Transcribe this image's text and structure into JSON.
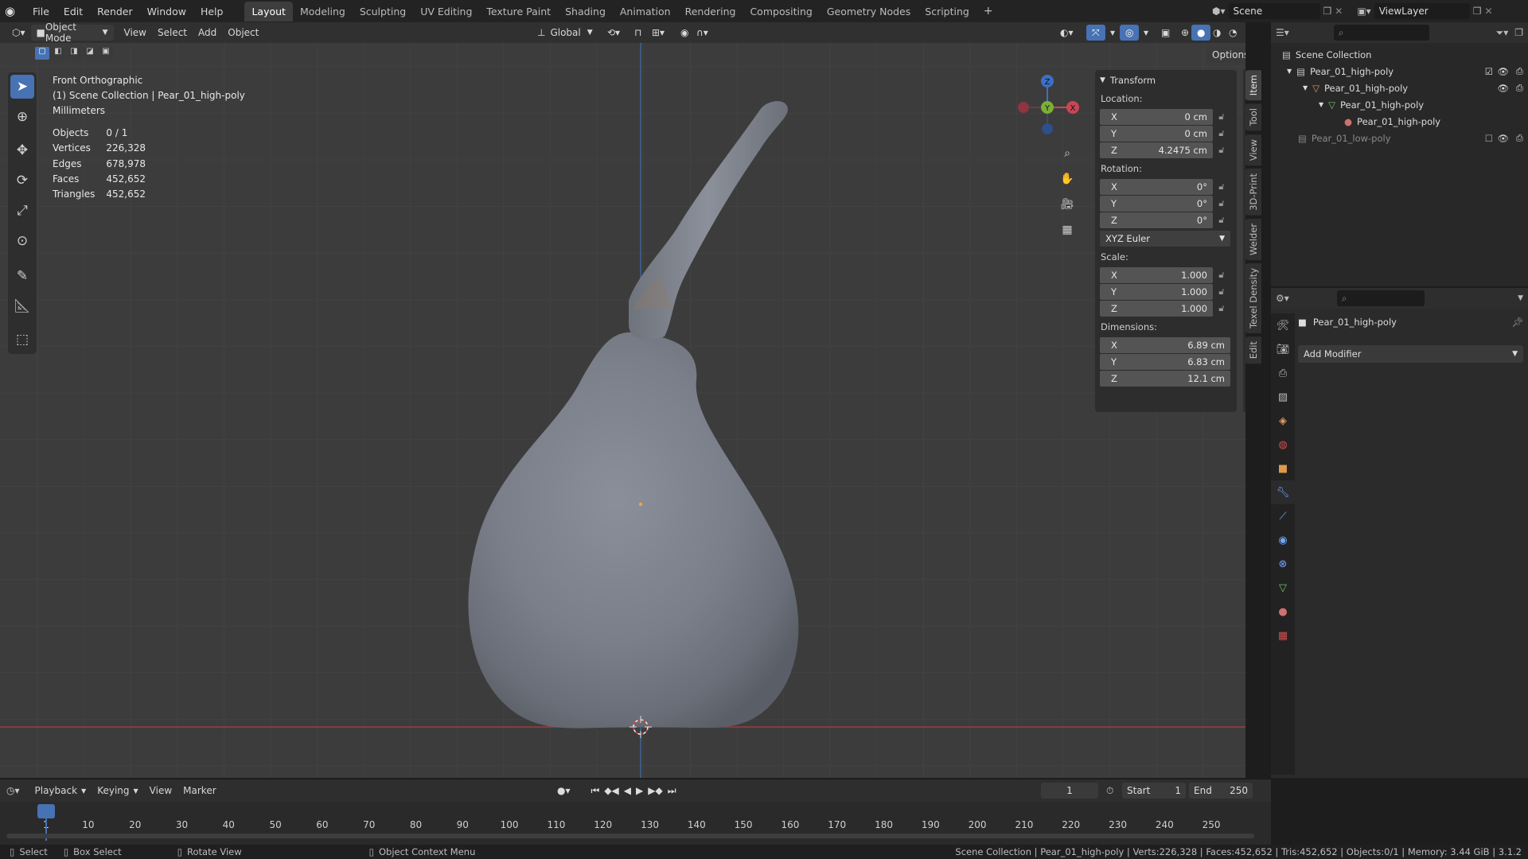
{
  "topbar": {
    "menus": [
      "File",
      "Edit",
      "Render",
      "Window",
      "Help"
    ],
    "workspaces": [
      "Layout",
      "Modeling",
      "Sculpting",
      "UV Editing",
      "Texture Paint",
      "Shading",
      "Animation",
      "Rendering",
      "Compositing",
      "Geometry Nodes",
      "Scripting"
    ],
    "active_workspace": "Layout",
    "add_workspace": "+",
    "scene": "Scene",
    "view_layer": "ViewLayer"
  },
  "viewport_header": {
    "mode": "Object Mode",
    "menus": [
      "View",
      "Select",
      "Add",
      "Object"
    ],
    "orientation": "Global",
    "options": "Options"
  },
  "viewport": {
    "view_name": "Front Orthographic",
    "collection_line": "(1) Scene Collection | Pear_01_high-poly",
    "units": "Millimeters",
    "stats": [
      {
        "label": "Objects",
        "value": "0 / 1"
      },
      {
        "label": "Vertices",
        "value": "226,328"
      },
      {
        "label": "Edges",
        "value": "678,978"
      },
      {
        "label": "Faces",
        "value": "452,652"
      },
      {
        "label": "Triangles",
        "value": "452,652"
      }
    ],
    "gizmo": {
      "z": "Z",
      "y": "Y",
      "x": "X"
    }
  },
  "transform": {
    "title": "Transform",
    "location_label": "Location:",
    "location": [
      {
        "axis": "X",
        "value": "0 cm"
      },
      {
        "axis": "Y",
        "value": "0 cm"
      },
      {
        "axis": "Z",
        "value": "4.2475 cm"
      }
    ],
    "rotation_label": "Rotation:",
    "rotation": [
      {
        "axis": "X",
        "value": "0°"
      },
      {
        "axis": "Y",
        "value": "0°"
      },
      {
        "axis": "Z",
        "value": "0°"
      }
    ],
    "rotation_mode": "XYZ Euler",
    "scale_label": "Scale:",
    "scale": [
      {
        "axis": "X",
        "value": "1.000"
      },
      {
        "axis": "Y",
        "value": "1.000"
      },
      {
        "axis": "Z",
        "value": "1.000"
      }
    ],
    "dimensions_label": "Dimensions:",
    "dimensions": [
      {
        "axis": "X",
        "value": "6.89 cm"
      },
      {
        "axis": "Y",
        "value": "6.83 cm"
      },
      {
        "axis": "Z",
        "value": "12.1 cm"
      }
    ]
  },
  "npanel_tabs": [
    "Item",
    "Tool",
    "View",
    "3D-Print",
    "Welder",
    "Texel Density",
    "Edit"
  ],
  "outliner": {
    "root": "Scene Collection",
    "items": [
      {
        "name": "Pear_01_high-poly",
        "depth": 1
      },
      {
        "name": "Pear_01_high-poly",
        "depth": 2
      },
      {
        "name": "Pear_01_high-poly",
        "depth": 3
      },
      {
        "name": "Pear_01_high-poly",
        "depth": 4
      },
      {
        "name": "Pear_01_low-poly",
        "depth": 1
      }
    ]
  },
  "properties": {
    "object_name": "Pear_01_high-poly",
    "add_modifier": "Add Modifier"
  },
  "timeline": {
    "menus": [
      "Playback",
      "Keying",
      "View",
      "Marker"
    ],
    "current_frame": "1",
    "start_label": "Start",
    "start": "1",
    "end_label": "End",
    "end": "250",
    "ticks": [
      "1",
      "10",
      "20",
      "30",
      "40",
      "50",
      "60",
      "70",
      "80",
      "90",
      "100",
      "110",
      "120",
      "130",
      "140",
      "150",
      "160",
      "170",
      "180",
      "190",
      "200",
      "210",
      "220",
      "230",
      "240",
      "250"
    ]
  },
  "statusbar": {
    "select": "Select",
    "box_select": "Box Select",
    "rotate_view": "Rotate View",
    "context_menu": "Object Context Menu",
    "info": "Scene Collection | Pear_01_high-poly | Verts:226,328 | Faces:452,652 | Tris:452,652 | Objects:0/1 | Memory: 3.44 GiB | 3.1.2"
  }
}
